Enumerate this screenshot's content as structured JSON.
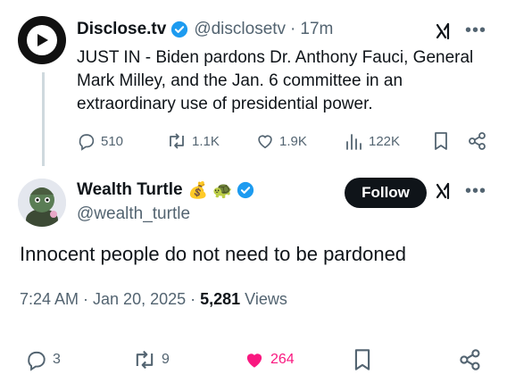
{
  "parent": {
    "name": "Disclose.tv",
    "handle": "@disclosetv",
    "time": "17m",
    "separator": "·",
    "text": "JUST IN - Biden pardons Dr. Anthony Fauci, General Mark Milley, and the Jan. 6 committee in an extraordinary use of presidential power.",
    "replies": "510",
    "reposts": "1.1K",
    "likes": "1.9K",
    "views": "122K",
    "icons": [
      "reply-icon",
      "repost-icon",
      "like-icon",
      "views-icon",
      "bookmark-icon",
      "share-icon",
      "verified-icon",
      "grok-icon",
      "more-icon"
    ]
  },
  "main": {
    "name": "Wealth Turtle",
    "emojis": "💰 🐢",
    "handle": "@wealth_turtle",
    "follow_label": "Follow",
    "text": "Innocent people do not need to be pardoned",
    "timestamp": "7:24 AM · Jan 20, 2025 · ",
    "views_count": "5,281",
    "views_label": " Views",
    "replies": "3",
    "reposts": "9",
    "likes": "264"
  },
  "colors": {
    "verified": "#1d9bf0",
    "like_active": "#f91880",
    "muted": "#536471",
    "text": "#0f1419"
  }
}
